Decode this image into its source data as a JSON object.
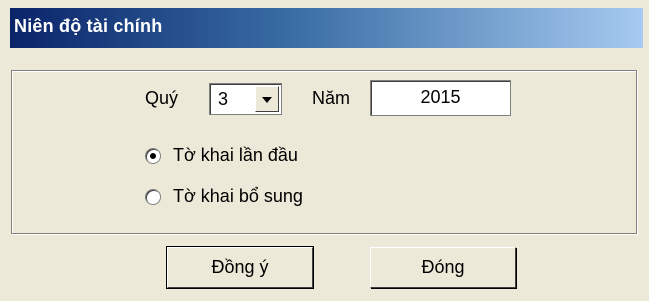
{
  "window": {
    "title": "Niên độ tài chính"
  },
  "form": {
    "quarter_label": "Quý",
    "quarter_value": "3",
    "year_label": "Năm",
    "year_value": "2015"
  },
  "radios": [
    {
      "label": "Tờ khai lần đầu",
      "checked": true
    },
    {
      "label": "Tờ khai bổ sung",
      "checked": false
    }
  ],
  "buttons": {
    "ok_label": "Đồng ý",
    "close_label": "Đóng"
  },
  "icons": {
    "dropdown": "chevron-down-icon"
  },
  "colors": {
    "title_start": "#0a246a",
    "title_end": "#a6caf0",
    "dialog_bg": "#ece9d8"
  }
}
